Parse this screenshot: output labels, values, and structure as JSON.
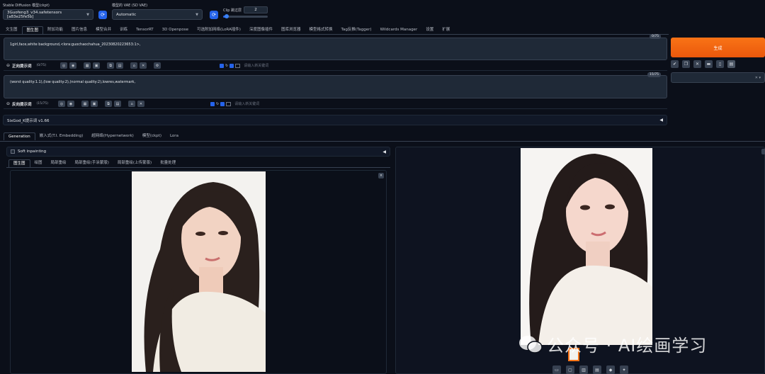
{
  "top": {
    "model_label": "Stable Diffusion 模型(ckpt)",
    "model_value": "3Guofeng3_v34.safetensors [a83e25fe5b]",
    "vae_label": "模型的 VAE (SD VAE)",
    "vae_value": "Automatic",
    "clip_label": "Clip 跳过层",
    "clip_value": "2",
    "clip_level": 0.08
  },
  "main_tabs": [
    "文生图",
    "图生图",
    "附加功能",
    "图片信息",
    "模型合并",
    "训练",
    "TensorRT",
    "3D Openpose",
    "可选附加网络(LoRA插件)",
    "深度图像插件",
    "图库浏览器",
    "模型格式转换",
    "Tag反推(Tagger)",
    "Wildcards Manager",
    "设置",
    "扩展"
  ],
  "main_tab_active": "图生图",
  "prompt": {
    "text": "1girl,face,white background,<lora:guochaochahua_20230820223653:1>,",
    "counter": "0/75",
    "label": "正向提示词",
    "label_counter": "(0/75)",
    "keyword_placeholder": "请输入新关键词"
  },
  "neg_prompt": {
    "text": "(worst quality:1.1),(low quality:2),(normal quality:2),lowres,watermark,",
    "counter": "15/75",
    "label": "反向提示词",
    "label_counter": "(15/75)",
    "keyword_placeholder": "请输入新关键词"
  },
  "generate_button": "生成",
  "sixgod_label": "SixGod_K提示词 v1.66",
  "sub_tabs": [
    "Generation",
    "嵌入式(T.I. Embedding)",
    "超网络(Hypernetwork)",
    "模型(ckpt)",
    "Lora"
  ],
  "soft_inpainting": "Soft inpainting",
  "img2img_tabs": [
    "图生图",
    "绘图",
    "局部重绘",
    "局部重绘(手涂蒙版)",
    "局部重绘(上传蒙版)",
    "批量处理"
  ],
  "watermark": "公众号 · AI绘画学习",
  "colors": {
    "accent": "#2563eb",
    "generate": "#f97316",
    "background": "#0b0f19"
  }
}
